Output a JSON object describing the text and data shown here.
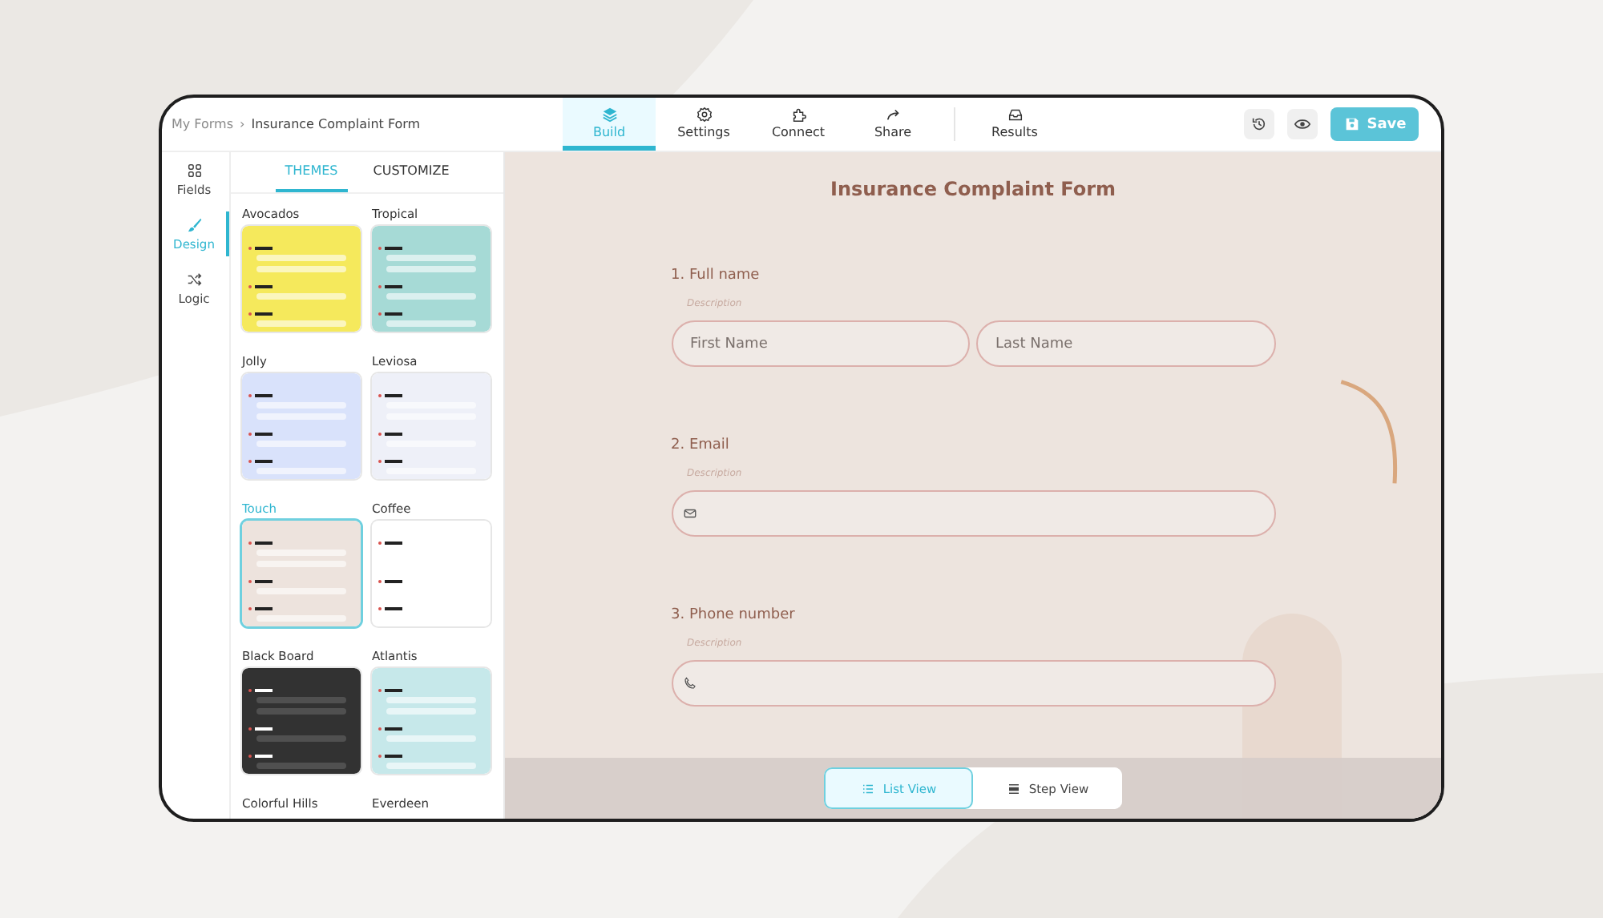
{
  "breadcrumb": {
    "root": "My Forms",
    "separator": "›",
    "current": "Insurance Complaint Form"
  },
  "nav_tabs": [
    {
      "label": "Build",
      "selected": true
    },
    {
      "label": "Settings",
      "selected": false
    },
    {
      "label": "Connect",
      "selected": false
    },
    {
      "label": "Share",
      "selected": false
    },
    {
      "label": "Results",
      "selected": false
    }
  ],
  "toolbar": {
    "save_label": "Save"
  },
  "sidebar": {
    "items": [
      {
        "label": "Fields",
        "selected": false
      },
      {
        "label": "Design",
        "selected": true
      },
      {
        "label": "Logic",
        "selected": false
      }
    ]
  },
  "panel_tabs": [
    {
      "label": "THEMES",
      "selected": true
    },
    {
      "label": "CUSTOMIZE",
      "selected": false
    }
  ],
  "themes": [
    {
      "name": "Avocados",
      "color": "#f5e95c",
      "selected": false
    },
    {
      "name": "Tropical",
      "color": "#a6dad6",
      "selected": false
    },
    {
      "name": "Jolly",
      "color": "#d9e2fb",
      "selected": false
    },
    {
      "name": "Leviosa",
      "color": "#eef0f8",
      "selected": false
    },
    {
      "name": "Touch",
      "color": "#ede3dd",
      "selected": true
    },
    {
      "name": "Coffee",
      "color": "#ffffff",
      "selected": false
    },
    {
      "name": "Black Board",
      "color": "#323232",
      "selected": false
    },
    {
      "name": "Atlantis",
      "color": "#c6e8ea",
      "selected": false
    },
    {
      "name": "Colorful Hills",
      "selected": false
    },
    {
      "name": "Everdeen",
      "selected": false
    }
  ],
  "form": {
    "title": "Insurance Complaint Form",
    "questions": [
      {
        "label": "1. Full name",
        "description": "Description",
        "kind": "name",
        "fields": [
          {
            "placeholder": "First Name"
          },
          {
            "placeholder": "Last Name"
          }
        ]
      },
      {
        "label": "2. Email",
        "description": "Description",
        "kind": "email"
      },
      {
        "label": "3. Phone number",
        "description": "Description",
        "kind": "phone"
      }
    ]
  },
  "view_toggle": [
    {
      "label": "List View",
      "selected": true
    },
    {
      "label": "Step View",
      "selected": false
    }
  ]
}
